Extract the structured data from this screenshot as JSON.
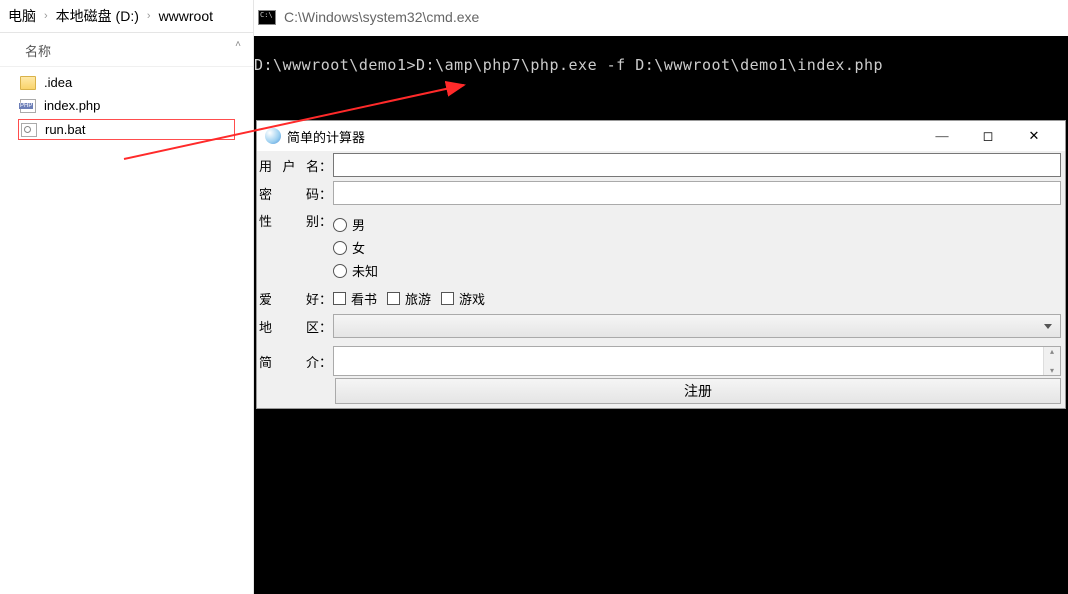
{
  "explorer": {
    "breadcrumb": [
      "电脑",
      "本地磁盘 (D:)",
      "wwwroot"
    ],
    "column_header": "名称",
    "files": [
      {
        "name": ".idea",
        "type": "folder"
      },
      {
        "name": "index.php",
        "type": "php"
      },
      {
        "name": "run.bat",
        "type": "bat",
        "selected": true
      }
    ]
  },
  "cmd": {
    "title": "C:\\Windows\\system32\\cmd.exe",
    "line": "D:\\wwwroot\\demo1>D:\\amp\\php7\\php.exe -f D:\\wwwroot\\demo1\\index.php"
  },
  "dialog": {
    "title": "简单的计算器",
    "labels": {
      "username": "用户名",
      "password": "密码",
      "gender": "性别",
      "hobby": "爱好",
      "region": "地区",
      "intro": "简介"
    },
    "colon": "：",
    "genders": [
      "男",
      "女",
      "未知"
    ],
    "hobbies": [
      "看书",
      "旅游",
      "游戏"
    ],
    "submit": "注册"
  }
}
